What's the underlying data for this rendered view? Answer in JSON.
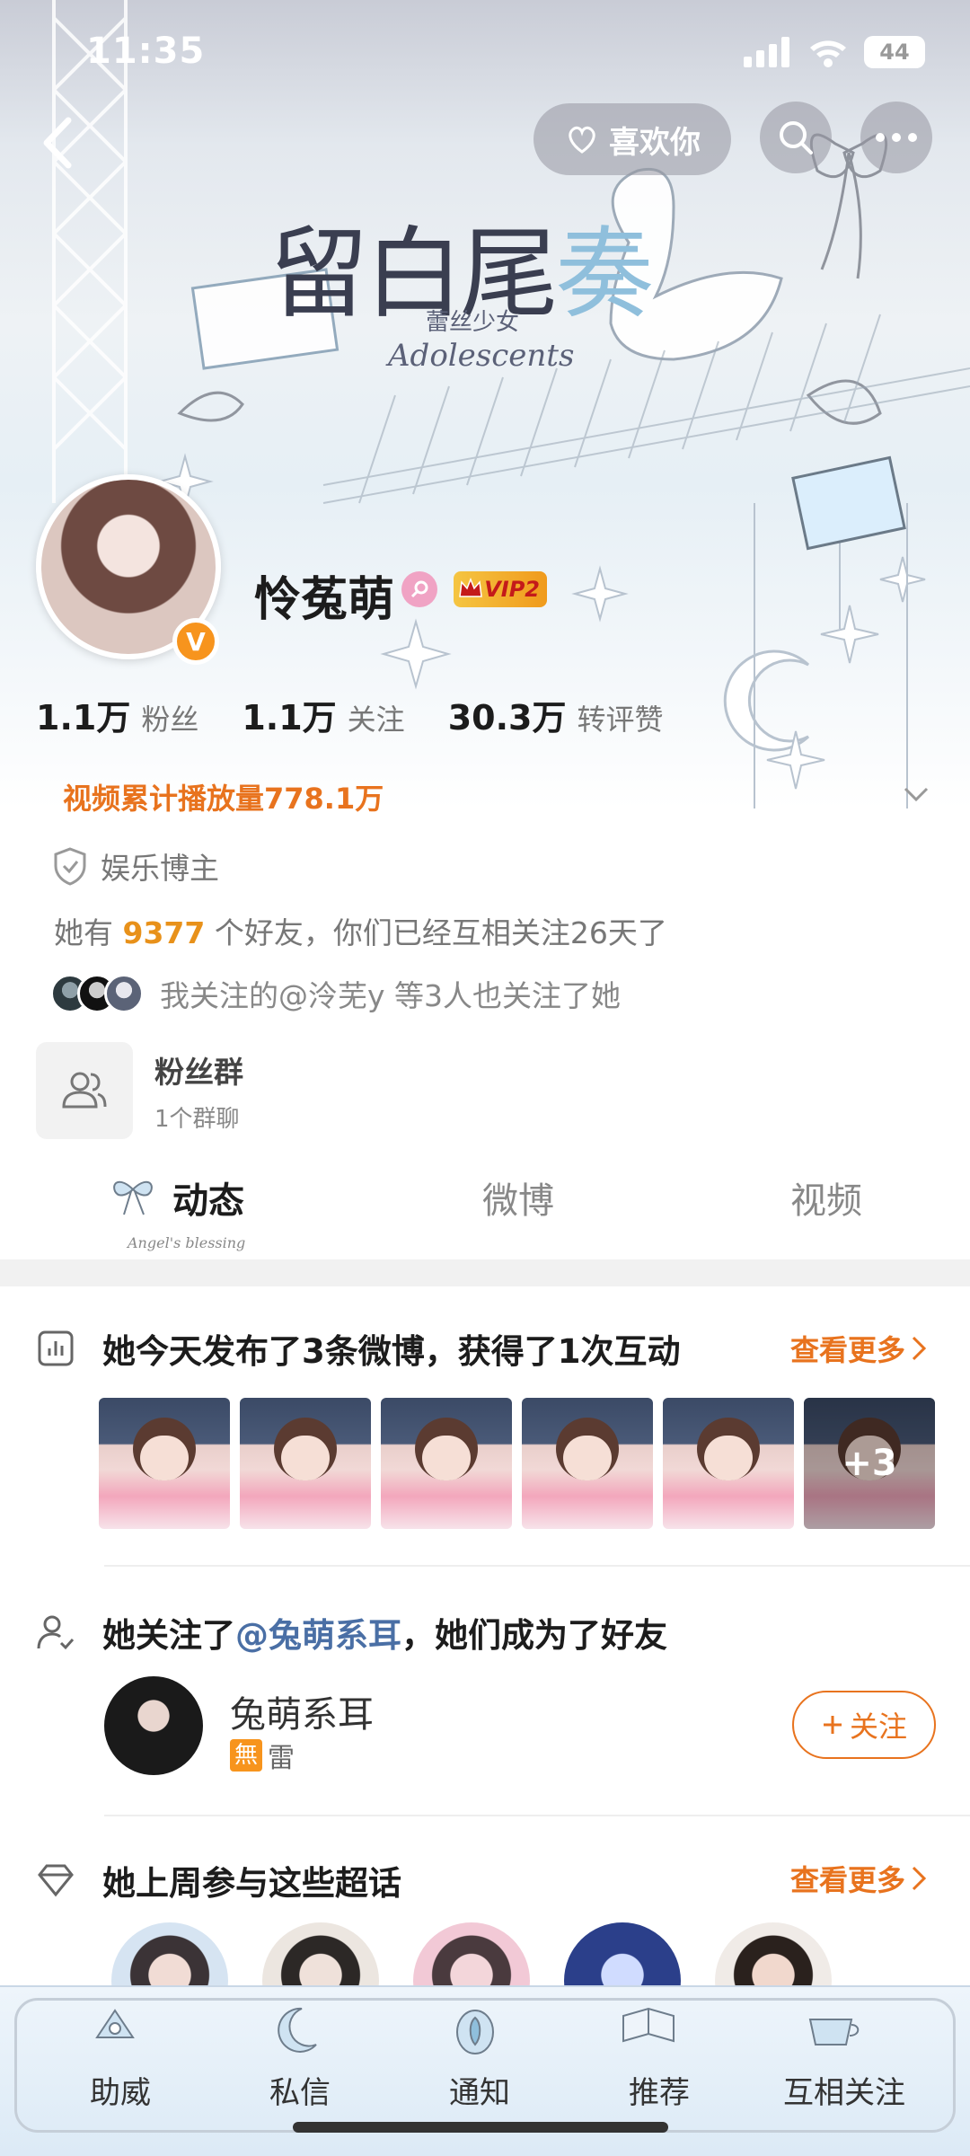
{
  "status_bar": {
    "time": "11:35",
    "battery": "44"
  },
  "header": {
    "like_label": "喜欢你"
  },
  "banner_art": {
    "title_a": "留白尾",
    "title_b": "奏",
    "subtitle_cn": "蕾丝少女",
    "subtitle_en": "Adolescents"
  },
  "profile": {
    "name": "怜菟萌",
    "vip_label": "VIP2",
    "verified_mark": "V",
    "stats": [
      {
        "num": "1.1万",
        "label": "粉丝"
      },
      {
        "num": "1.1万",
        "label": "关注"
      },
      {
        "num": "30.3万",
        "label": "转评赞"
      }
    ],
    "play_count": "视频累计播放量778.1万"
  },
  "info": {
    "tag": "娱乐博主",
    "friend_prefix": "她有",
    "friend_count": "9377",
    "friend_suffix": "个好友，你们已经互相关注26天了",
    "mutual": "我关注的@泠芜y 等3人也关注了她"
  },
  "fan_group": {
    "title": "粉丝群",
    "subtitle": "1个群聊"
  },
  "tabs": [
    {
      "label": "动态",
      "active": true
    },
    {
      "label": "微博",
      "active": false
    },
    {
      "label": "视频",
      "active": false
    }
  ],
  "tab_deco_text": "Angel's blessing",
  "feed": {
    "summary": "她今天发布了3条微博，获得了1次互动",
    "more_label": "查看更多",
    "thumb_more": "+3",
    "follow_prefix": "她关注了",
    "follow_link": "@兔萌系耳",
    "follow_suffix": "，她们成为了好友",
    "user_name": "兔萌系耳",
    "user_tag_box": "無",
    "user_tag_text": "雷",
    "follow_button": "关注",
    "topics_title": "她上周参与这些超话",
    "topics_more": "查看更多"
  },
  "bottom_nav": [
    {
      "label": "助威"
    },
    {
      "label": "私信"
    },
    {
      "label": "通知"
    },
    {
      "label": "推荐"
    },
    {
      "label": "互相关注"
    }
  ],
  "colors": {
    "accent": "#e8731e",
    "link": "#4a6fa5",
    "friend_num": "#e8911a"
  }
}
